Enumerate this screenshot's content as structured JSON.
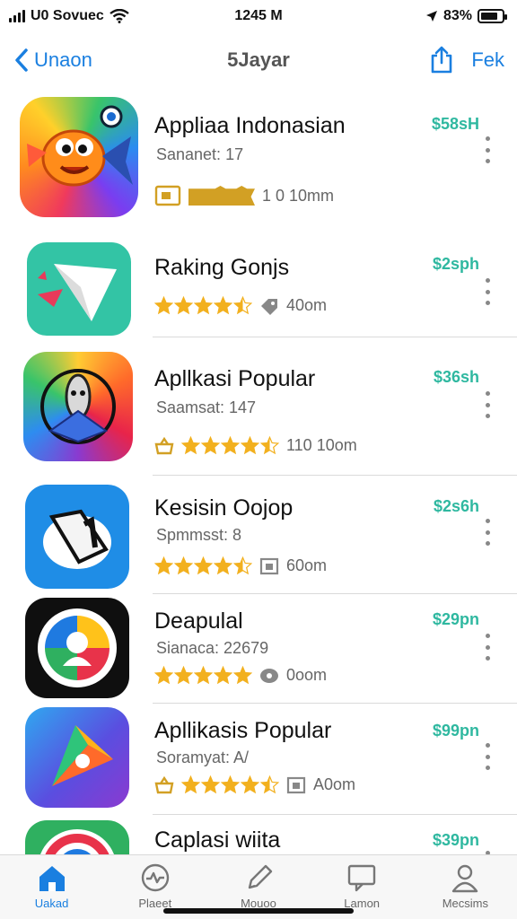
{
  "status_bar": {
    "carrier": "U0 Sovuec",
    "time": "1245 M",
    "battery": "83%",
    "battery_level": 0.83,
    "icons": [
      "signal-icon",
      "wifi-icon",
      "location-arrow-icon",
      "battery-icon"
    ]
  },
  "nav": {
    "back_label": "Unaon",
    "title": "5Jayar",
    "action_label": "Fek",
    "icons": [
      "back-chevron-icon",
      "share-icon"
    ]
  },
  "apps": [
    {
      "name": "Appliaa Indonasian",
      "subtitle": "Sananet: 17",
      "price": "$58sH",
      "meta_text": "1 0 10mm",
      "rating": 3,
      "meta_icon": "tag-badge-icon"
    },
    {
      "name": "Raking Gonjs",
      "subtitle": "",
      "price": "$2sph",
      "meta_text": "40om",
      "rating": 4.5,
      "meta_icon": "tag-icon"
    },
    {
      "name": "Apllkasi Popular",
      "subtitle": "Saamsat: 147",
      "price": "$36sh",
      "meta_text": "110 10om",
      "rating": 4.5,
      "meta_icon": "basket-icon"
    },
    {
      "name": "Kesisin Oojop",
      "subtitle": "Spmmsst: 8",
      "price": "$2s6h",
      "meta_text": "60om",
      "rating": 4.5,
      "meta_icon": "calendar-icon"
    },
    {
      "name": "Deapulal",
      "subtitle": "Sianaca: 22679",
      "price": "$29pn",
      "meta_text": "0oom",
      "rating": 5,
      "meta_icon": "tag-icon"
    },
    {
      "name": "Apllikasis Popular",
      "subtitle": "Soramyat: A/",
      "price": "$99pn",
      "meta_text": "A0om",
      "rating": 4.5,
      "meta_icon": "basket-icon"
    },
    {
      "name": "Caplasi wiita",
      "subtitle": "",
      "price": "$39pn",
      "meta_text": "",
      "rating": 0,
      "meta_icon": ""
    }
  ],
  "tabs": [
    {
      "label": "Uakad",
      "icon": "home-icon",
      "active": true
    },
    {
      "label": "Plaeet",
      "icon": "activity-circle-icon",
      "active": false
    },
    {
      "label": "Mouoo",
      "icon": "pencil-icon",
      "active": false
    },
    {
      "label": "Lamon",
      "icon": "message-icon",
      "active": false
    },
    {
      "label": "Mecsims",
      "icon": "person-icon",
      "active": false
    }
  ],
  "colors": {
    "accent": "#1a7fe0",
    "price": "#2fb8a0",
    "star": "#f2b01e"
  }
}
